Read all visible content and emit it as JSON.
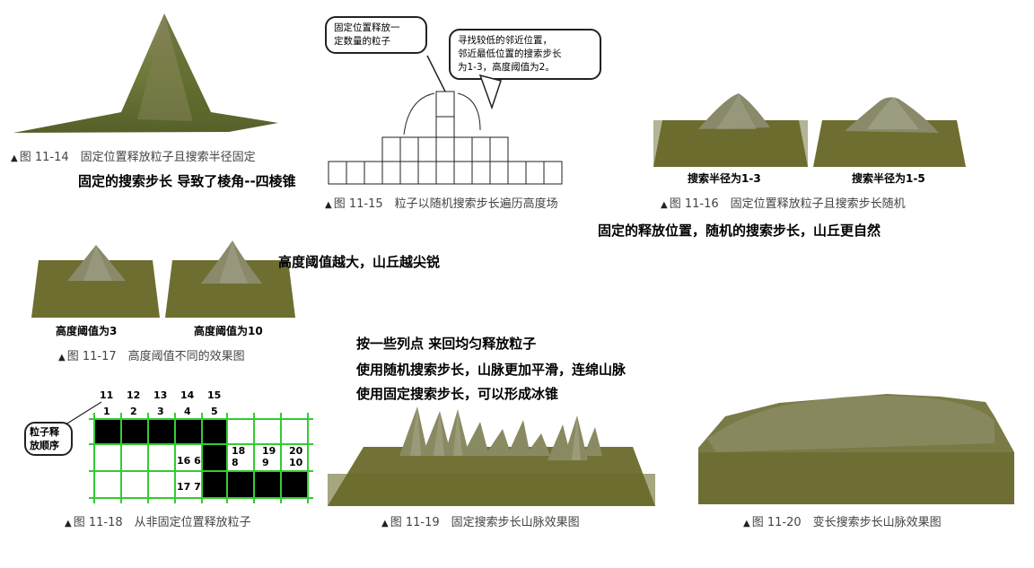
{
  "figures": {
    "f14": {
      "caption": "图 11-14　固定位置释放粒子且搜索半径固定"
    },
    "f15": {
      "caption": "图 11-15　粒子以随机搜索步长遍历高度场",
      "bubble_left": [
        "固定位置释放一",
        "定数量的粒子"
      ],
      "bubble_right": [
        "寻找较低的邻近位置，",
        "邻近最低位置的搜索步长",
        "为1-3，高度阈值为2。"
      ]
    },
    "f16": {
      "caption": "图 11-16　固定位置释放粒子且搜索步长随机",
      "label_a": "搜索半径为1-3",
      "label_b": "搜索半径为1-5"
    },
    "f17": {
      "caption": "图 11-17　高度阈值不同的效果图",
      "label_a": "高度阈值为3",
      "label_b": "高度阈值为10"
    },
    "f18": {
      "caption": "图 11-18　从非固定位置释放粒子",
      "bubble": [
        "粒子释",
        "放顺序"
      ],
      "top_numbers": [
        "11",
        "12",
        "13",
        "14",
        "15"
      ],
      "row_numbers": [
        "1",
        "2",
        "3",
        "4",
        "5"
      ],
      "cell_labels": [
        "18\n8",
        "19\n9",
        "20\n10",
        "16 6",
        "17 7"
      ]
    },
    "f19": {
      "caption": "图 11-19　固定搜索步长山脉效果图"
    },
    "f20": {
      "caption": "图 11-20　变长搜索步长山脉效果图"
    }
  },
  "notes": {
    "n1": "固定的搜索步长 导致了棱角--四棱锥",
    "n2": "固定的释放位置，随机的搜索步长，山丘更自然",
    "n3": "高度阈值越大，山丘越尖锐",
    "n4": "按一些列点 来回均匀释放粒子",
    "n5": "使用随机搜索步长，山脉更加平滑，连绵山脉",
    "n6": "使用固定搜索步长，可以形成冰锥"
  },
  "colors": {
    "grass": "#7a7a3a",
    "grass_dark": "#5a5a28",
    "grid_green": "#33cc33",
    "cell_black": "#000000"
  }
}
